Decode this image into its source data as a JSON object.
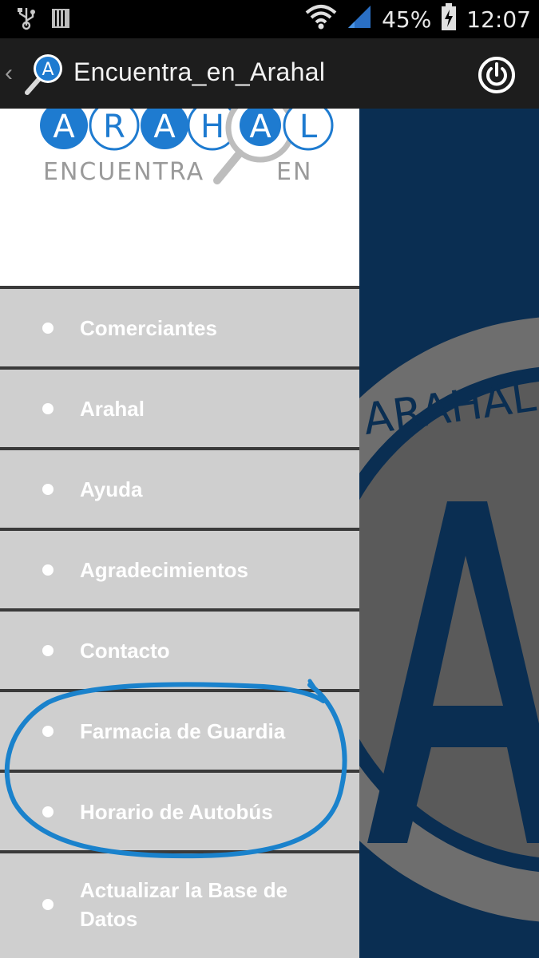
{
  "status_bar": {
    "battery": "45%",
    "time": "12:07"
  },
  "action_bar": {
    "title": "Encuentra_en_Arahal"
  },
  "logo": {
    "letters": [
      "A",
      "R",
      "A",
      "H",
      "A",
      "L"
    ],
    "line2_left": "ENCUENTRA",
    "line2_right": "EN"
  },
  "background": {
    "watermark_text": "ARAHAL",
    "watermark_letter": "A"
  },
  "menu": {
    "items": [
      {
        "label": "Comerciantes"
      },
      {
        "label": "Arahal"
      },
      {
        "label": "Ayuda"
      },
      {
        "label": "Agradecimientos"
      },
      {
        "label": "Contacto"
      },
      {
        "label": "Farmacia de Guardia"
      },
      {
        "label": "Horario de Autobús"
      },
      {
        "label": "Actualizar la Base de Datos"
      }
    ]
  },
  "colors": {
    "brand_blue": "#1e7bd0",
    "dark_navy": "#0a2e52",
    "drawer_bg": "#cfcfcf",
    "annotation_blue": "#1a82cc"
  }
}
